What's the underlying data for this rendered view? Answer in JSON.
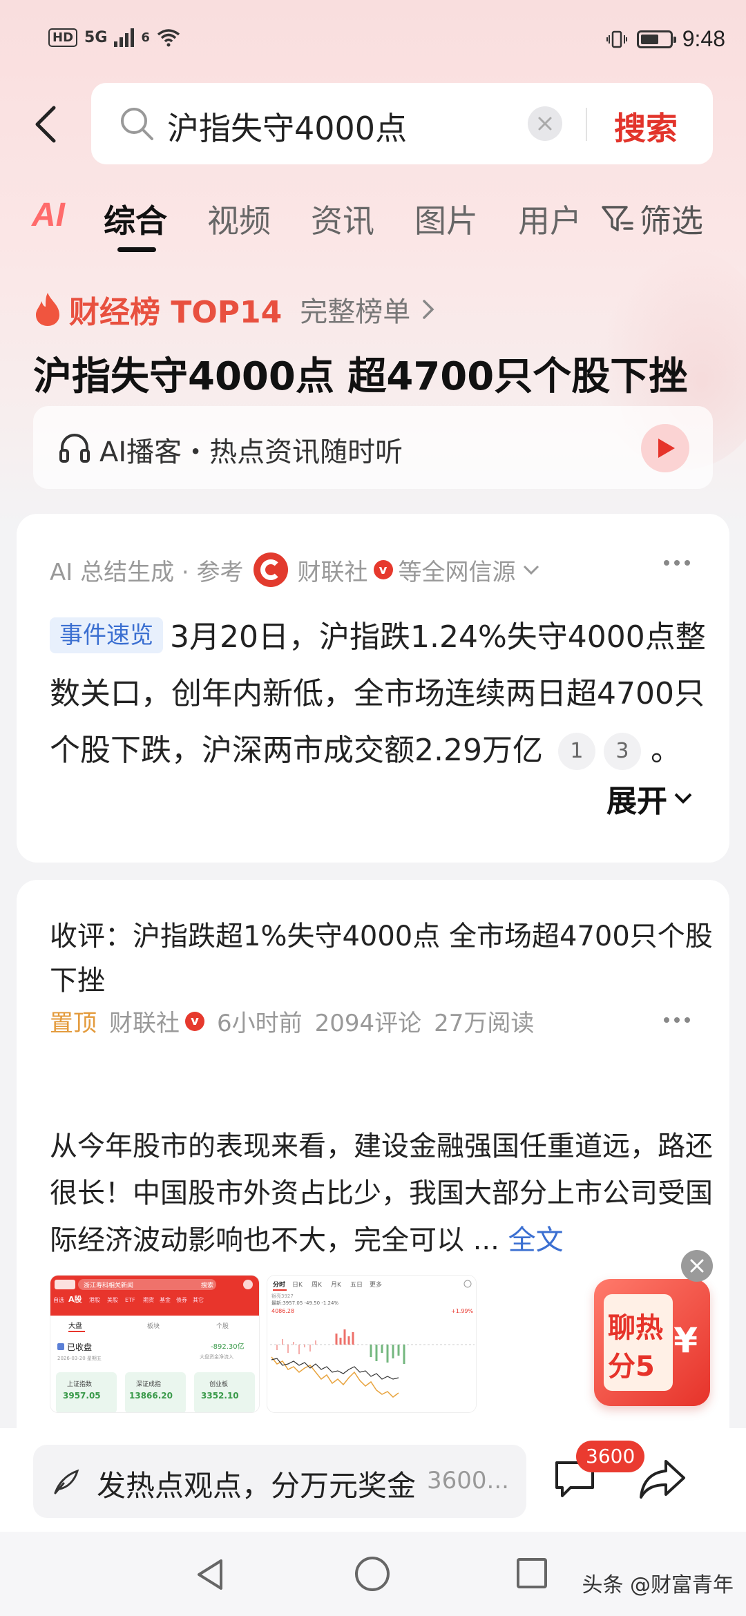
{
  "status_bar": {
    "hd": "HD",
    "network": "5G",
    "wifi_tag": "6",
    "time": "9:48"
  },
  "search": {
    "query": "沪指失守4000点",
    "button": "搜索"
  },
  "tabs": {
    "ai": "AI",
    "items": [
      "综合",
      "视频",
      "资讯",
      "图片",
      "用户"
    ],
    "filter": "筛选",
    "active": "综合"
  },
  "ranking": {
    "title": "财经榜 TOP14",
    "link": "完整榜单"
  },
  "headline": "沪指失守4000点 超4700只个股下挫",
  "podcast": {
    "text": "AI播客・热点资讯随时听"
  },
  "summary_card": {
    "source_prefix": "AI 总结生成 · 参考",
    "source_name": "财联社",
    "source_suffix": "等全网信源",
    "tag": "事件速览",
    "text": "3月20日，沪指跌1.24%失守4000点整数关口，创年内新低，全市场连续两日超4700只个股下跌，沪深两市成交额2.29万亿",
    "refs": [
      "1",
      "3"
    ],
    "end": "。",
    "expand": "展开"
  },
  "post_card": {
    "title": "收评：沪指跌超1%失守4000点 全市场超4700只个股下挫",
    "pin": "置顶",
    "source": "财联社",
    "time": "6小时前",
    "comments": "2094评论",
    "reads": "27万阅读",
    "body": "从今年股市的表现来看，建设金融强国任重道远，路还很长！中国股市外资占比少，我国大部分上市公司受国际经济波动影响也不大，完全可以 ...",
    "fulltext": "全文"
  },
  "thumb1": {
    "search": "浙江寿科相关新闻",
    "search_btn": "搜索",
    "tabs": [
      "自选",
      "A股",
      "港股",
      "美股",
      "ETF",
      "期货",
      "基金",
      "债券",
      "其它"
    ],
    "sub_tabs": [
      "大盘",
      "板块",
      "个股"
    ],
    "status": "已收盘",
    "date": "2026-03-20 星期五",
    "flow": "-892.30亿",
    "flow_label": "大盘资金净流入",
    "indices": [
      {
        "name": "上证指数",
        "value": "3957.05"
      },
      {
        "name": "深证成指",
        "value": "13866.20"
      },
      {
        "name": "创业板",
        "value": "3352.10"
      }
    ]
  },
  "thumb2": {
    "tabs": [
      "分时",
      "日K",
      "周K",
      "月K",
      "五日",
      "更多"
    ],
    "title": "银亮3927",
    "latest": "最新:3957.05 -49.50 -1.24%",
    "high": "4086.28",
    "pct": "+1.99%"
  },
  "float_ad": {
    "line1": "聊热",
    "line2": "分5",
    "yen": "¥"
  },
  "bottom_bar": {
    "placeholder": "发热点观点，分万元奖金",
    "count_text": "3600...",
    "badge": "3600"
  },
  "watermark": "头条 @财富青年",
  "colors": {
    "brand_red": "#e2342b",
    "link_blue": "#3b6fd1",
    "pin_orange": "#e39a3b"
  }
}
